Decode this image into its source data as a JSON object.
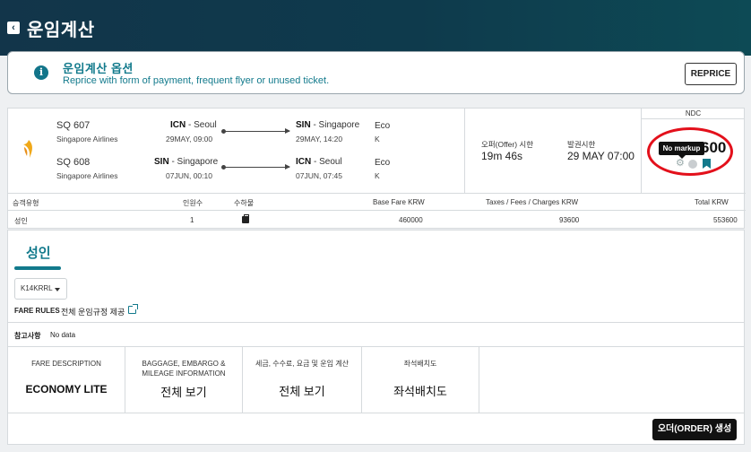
{
  "header": {
    "title": "운임계산",
    "back_icon": "chevron-left-icon"
  },
  "options": {
    "title": "운임계산 옵션",
    "subtitle": "Reprice with form of payment, frequent flyer or unused ticket.",
    "reprice_label": "REPRICE"
  },
  "segments": [
    {
      "flight_no": "SQ 607",
      "airline": "Singapore Airlines",
      "dep_code": "ICN",
      "dep_city": " - Seoul",
      "dep_dt": "29MAY, 09:00",
      "arr_code": "SIN",
      "arr_city": " - Singapore",
      "arr_dt": "29MAY, 14:20",
      "cabin": "Eco",
      "rbd": "K"
    },
    {
      "flight_no": "SQ 608",
      "airline": "Singapore Airlines",
      "dep_code": "SIN",
      "dep_city": " - Singapore",
      "dep_dt": "07JUN, 00:10",
      "arr_code": "ICN",
      "arr_city": " - Seoul",
      "arr_dt": "07JUN, 07:45",
      "cabin": "Eco",
      "rbd": "K"
    }
  ],
  "offer": {
    "time_label": "오퍼(Offer) 시한",
    "time_value": "19m  46s",
    "ticket_label": "발권시한",
    "ticket_value": "29 MAY 07:00"
  },
  "ndc": {
    "label": "NDC",
    "price_partial": "600",
    "tooltip": "No markup"
  },
  "pax_table": {
    "headers": {
      "type": "승객유형",
      "count": "인원수",
      "baggage": "수하물",
      "base": "Base Fare KRW",
      "taxes": "Taxes / Fees / Charges KRW",
      "total": "Total KRW"
    },
    "row": {
      "type": "성인",
      "count": "1",
      "base": "460000",
      "taxes": "93600",
      "total": "553600"
    }
  },
  "detail": {
    "tab": "성인",
    "fare_basis": "K14KRRL",
    "fare_rules_label": "FARE RULES",
    "fare_rules_link": "전체 운임규정 제공",
    "notes_label": "참고사항",
    "notes_value": "No data",
    "cells": [
      {
        "head": "FARE DESCRIPTION",
        "value": "ECONOMY LITE"
      },
      {
        "head": "BAGGAGE, EMBARGO &\nMILEAGE INFORMATION",
        "value": "전체 보기"
      },
      {
        "head": "세금, 수수료, 요금 및 운임 계산",
        "value": "전체 보기"
      },
      {
        "head": "좌석배치도",
        "value": "좌석배치도"
      }
    ],
    "order_label": "오더(ORDER) 생성"
  },
  "colors": {
    "header": "#12354a",
    "accent": "#127a8c",
    "highlight": "#e3101b"
  }
}
